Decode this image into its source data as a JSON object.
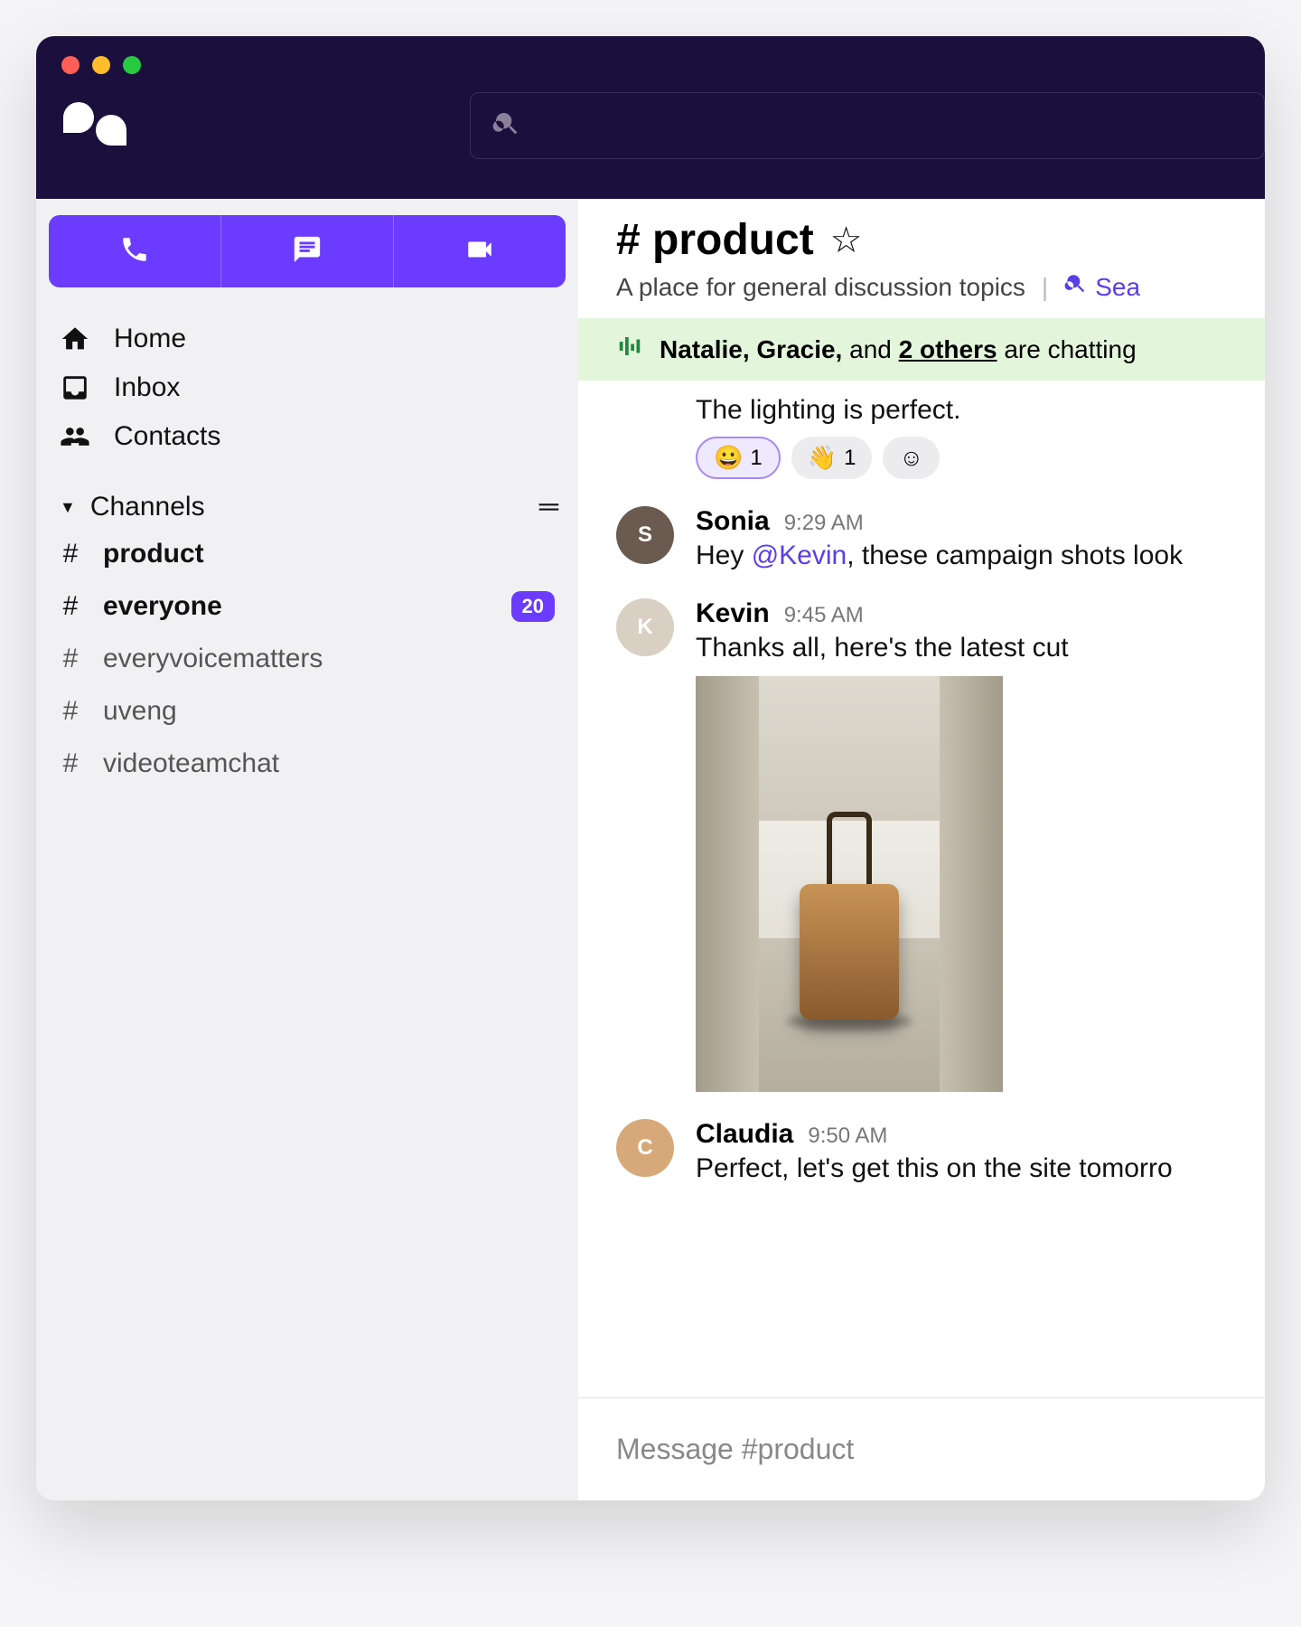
{
  "colors": {
    "accent": "#6b3bff",
    "mention": "#5a3ee8",
    "chatting_bg": "#e3f6dc"
  },
  "search": {
    "placeholder": ""
  },
  "sidebar": {
    "nav": [
      {
        "label": "Home"
      },
      {
        "label": "Inbox"
      },
      {
        "label": "Contacts"
      }
    ],
    "channels_header": "Channels",
    "channels": [
      {
        "name": "product",
        "bold": true
      },
      {
        "name": "everyone",
        "bold": true,
        "badge": "20"
      },
      {
        "name": "everyvoicematters",
        "bold": false
      },
      {
        "name": "uveng",
        "bold": false
      },
      {
        "name": "videoteamchat",
        "bold": false
      }
    ]
  },
  "channel": {
    "title": "# product",
    "subtitle": "A place for general discussion topics",
    "search_label": "Sea"
  },
  "chatting_bar": {
    "names": "Natalie, Gracie,",
    "and": " and ",
    "others": "2 others",
    "suffix": " are chatting"
  },
  "orphan_message": "The lighting is perfect.",
  "reactions": [
    {
      "emoji": "😀",
      "count": "1",
      "active": true
    },
    {
      "emoji": "👋",
      "count": "1",
      "active": false
    }
  ],
  "add_reaction_emoji": "☺",
  "messages": [
    {
      "author": "Sonia",
      "time": "9:29 AM",
      "avatar_bg": "#6b5a4f",
      "avatar_initial": "S",
      "text_pre": "Hey ",
      "mention": "@Kevin",
      "text_post": ", these campaign shots look"
    },
    {
      "author": "Kevin",
      "time": "9:45 AM",
      "avatar_bg": "#d9cfc3",
      "avatar_initial": "K",
      "text": "Thanks all, here's the latest cut",
      "has_attachment": true
    },
    {
      "author": "Claudia",
      "time": "9:50 AM",
      "avatar_bg": "#d7a97a",
      "avatar_initial": "C",
      "text": "Perfect, let's get this on the site tomorro"
    }
  ],
  "composer": {
    "placeholder": "Message #product"
  }
}
